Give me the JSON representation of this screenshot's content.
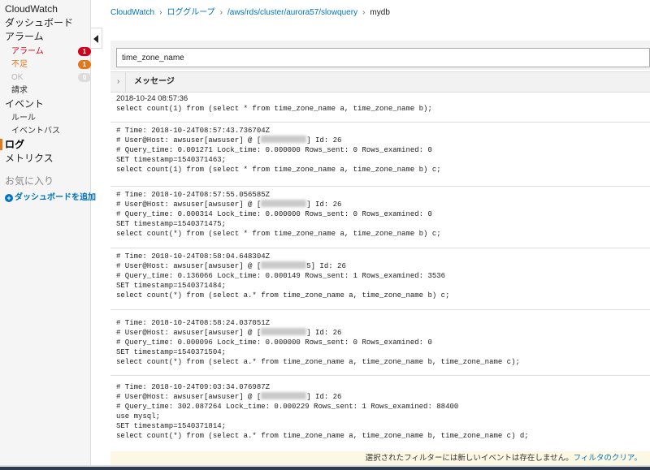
{
  "sidebar": {
    "title": "CloudWatch",
    "dashboard": "ダッシュボード",
    "alarm_header": "アラーム",
    "alarm": {
      "label": "アラーム",
      "count": "1"
    },
    "insufficient": {
      "label": "不足",
      "count": "1"
    },
    "ok": {
      "label": "OK",
      "count": "0"
    },
    "billing": "請求",
    "events": "イベント",
    "rules": "ルール",
    "event_buses": "イベントバス",
    "logs": "ログ",
    "metrics": "メトリクス",
    "favorites": "お気に入り",
    "add_dashboard": "ダッシュボードを追加"
  },
  "breadcrumb": {
    "cloudwatch": "CloudWatch",
    "log_groups": "ロググループ",
    "group": "/aws/rds/cluster/aurora57/slowquery",
    "stream": "mydb"
  },
  "filter": {
    "value": "time_zone_name"
  },
  "table": {
    "message_header": "メッセージ"
  },
  "entries": [
    {
      "timestamp": "2018-10-24 08:57:36",
      "query": "select count(1) from (select * from time_zone_name a, time_zone_name b);"
    },
    {
      "time": "# Time: 2018-10-24T08:57:43.736704Z",
      "user_prefix": "# User@Host: awsuser[awsuser] @ [",
      "user_suffix": "] Id: 26",
      "stats": "# Query_time: 0.001271 Lock_time: 0.000000 Rows_sent: 0 Rows_examined: 0",
      "set_ts": "SET timestamp=1540371463;",
      "query": "select count(1) from (select * from time_zone_name a, time_zone_name b) c;"
    },
    {
      "time": "# Time: 2018-10-24T08:57:55.056585Z",
      "user_prefix": "# User@Host: awsuser[awsuser] @ [",
      "user_suffix": "] Id: 26",
      "stats": "# Query_time: 0.000314 Lock_time: 0.000000 Rows_sent: 0 Rows_examined: 0",
      "set_ts": "SET timestamp=1540371475;",
      "query": "select count(*) from (select * from time_zone_name a, time_zone_name b) c;"
    },
    {
      "time": "# Time: 2018-10-24T08:58:04.648304Z",
      "user_prefix": "# User@Host: awsuser[awsuser] @ [",
      "user_suffix": "5] Id: 26",
      "stats": "# Query_time: 0.136066 Lock_time: 0.000149 Rows_sent: 1 Rows_examined: 3536",
      "set_ts": "SET timestamp=1540371484;",
      "query": "select count(*) from (select a.* from time_zone_name a, time_zone_name b) c;"
    },
    {
      "time": "# Time: 2018-10-24T08:58:24.037051Z",
      "user_prefix": "# User@Host: awsuser[awsuser] @ [",
      "user_suffix": "] Id: 26",
      "stats": "# Query_time: 0.000096 Lock_time: 0.000000 Rows_sent: 0 Rows_examined: 0",
      "set_ts": "SET timestamp=1540371504;",
      "query": "select count(*) from (select a.* from time_zone_name a, time_zone_name b, time_zone_name c);"
    },
    {
      "time": "# Time: 2018-10-24T09:03:34.076987Z",
      "user_prefix": "# User@Host: awsuser[awsuser] @ [",
      "user_suffix": "] Id: 26",
      "stats": "# Query_time: 302.087264 Lock_time: 0.000229 Rows_sent: 1 Rows_examined: 88400",
      "use_db": "use mysql;",
      "set_ts": "SET timestamp=1540371814;",
      "query": "select count(*) from (select a.* from time_zone_name a, time_zone_name b, time_zone_name c) d;"
    }
  ],
  "footer": {
    "message": "選択されたフィルターには新しいイベントは存在しません。",
    "clear_link": "フィルタのクリア。"
  }
}
